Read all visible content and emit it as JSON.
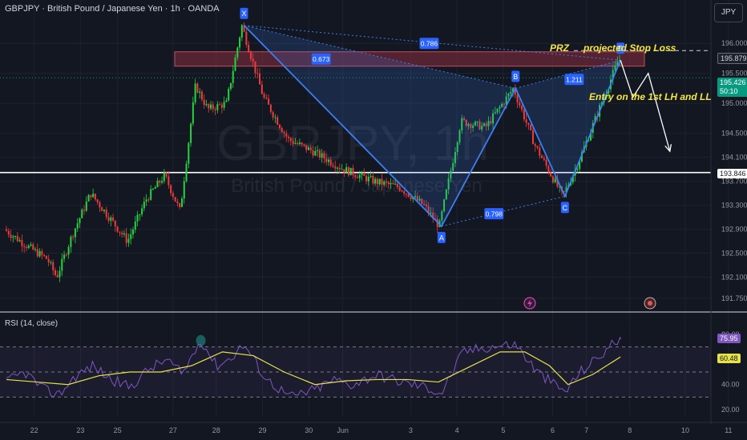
{
  "header": {
    "symbol_title": "GBPJPY · British Pound / Japanese Yen · 1h · OANDA",
    "currency_button": "JPY"
  },
  "watermark": {
    "symbol": "GBPJPY, 1h",
    "description": "British Pound / Japanese Yen"
  },
  "colors": {
    "background": "#131722",
    "grid": "#1e2230",
    "up": "#26d340",
    "down": "#ef3b3b",
    "pattern": "#3d7ef0",
    "rsi_line": "#7e57c2",
    "rsi_ma": "#e6e24a",
    "zone": "#8b2e40",
    "annotation": "#f5e63c",
    "support": "#ffffff"
  },
  "price_tags": {
    "stop": "195.879",
    "current": "195.426",
    "countdown": "50:10",
    "support": "193.846",
    "rsi_value": "75.95",
    "rsi_ma_value": "60.48"
  },
  "annotations": {
    "prz": "PRZ",
    "stop_loss": "projected Stop Loss",
    "entry": "Entry on the 1st LH and LL"
  },
  "pattern": {
    "type": "bat",
    "points": [
      {
        "label": "X",
        "day": 3.85,
        "price": 196.3
      },
      {
        "label": "A",
        "day": 7.05,
        "price": 192.95
      },
      {
        "label": "B",
        "day": 8.25,
        "price": 195.25
      },
      {
        "label": "C",
        "day": 9.05,
        "price": 193.45
      },
      {
        "label": "D",
        "day": 9.95,
        "price": 195.72
      }
    ],
    "ratios": [
      {
        "label": "0.673",
        "day": 5.1,
        "price": 195.74
      },
      {
        "label": "0.786",
        "day": 6.85,
        "price": 196.0
      },
      {
        "label": "1.211",
        "day": 9.2,
        "price": 195.4
      },
      {
        "label": "0.798",
        "day": 7.9,
        "price": 193.16
      }
    ]
  },
  "chart_data": {
    "type": "candlestick",
    "title": "GBPJPY · British Pound / Japanese Yen · 1h · OANDA",
    "x_ticks": [
      "22",
      "23",
      "25",
      "27",
      "28",
      "29",
      "30",
      "Jun",
      "3",
      "4",
      "5",
      "6",
      "7",
      "8",
      "10",
      "11"
    ],
    "y_ticks": [
      "196.000",
      "195.500",
      "195.000",
      "194.500",
      "194.100",
      "193.700",
      "193.300",
      "192.900",
      "192.500",
      "192.100",
      "191.750"
    ],
    "ylim": [
      191.6,
      196.35
    ],
    "prz_zone": [
      195.62,
      195.86
    ],
    "support_level": 193.846,
    "stop_loss_level": 195.879,
    "current_price": 195.426,
    "price_path": [
      [
        0.0,
        192.9
      ],
      [
        0.4,
        192.6
      ],
      [
        0.7,
        192.4
      ],
      [
        0.85,
        192.1
      ],
      [
        1.1,
        192.8
      ],
      [
        1.4,
        193.5
      ],
      [
        1.7,
        193.1
      ],
      [
        2.0,
        192.7
      ],
      [
        2.3,
        193.4
      ],
      [
        2.6,
        193.8
      ],
      [
        2.85,
        193.2
      ],
      [
        3.1,
        195.3
      ],
      [
        3.3,
        194.9
      ],
      [
        3.6,
        195.0
      ],
      [
        3.85,
        196.3
      ],
      [
        4.2,
        195.1
      ],
      [
        4.6,
        194.4
      ],
      [
        5.0,
        194.2
      ],
      [
        5.5,
        193.9
      ],
      [
        6.0,
        193.7
      ],
      [
        6.4,
        193.6
      ],
      [
        6.8,
        193.3
      ],
      [
        7.05,
        192.95
      ],
      [
        7.4,
        194.7
      ],
      [
        7.8,
        194.6
      ],
      [
        8.25,
        195.25
      ],
      [
        8.6,
        194.3
      ],
      [
        9.05,
        193.45
      ],
      [
        9.3,
        194.0
      ],
      [
        9.6,
        194.8
      ],
      [
        9.95,
        195.72
      ]
    ],
    "projection": [
      [
        9.95,
        195.72
      ],
      [
        10.15,
        195.1
      ],
      [
        10.4,
        195.5
      ],
      [
        10.75,
        194.2
      ]
    ],
    "rsi": {
      "title": "RSI (14, close)",
      "y_ticks": [
        "80.00",
        "60.00",
        "40.00",
        "20.00"
      ],
      "ylim": [
        15,
        85
      ],
      "bands": [
        70,
        50,
        30
      ],
      "value": 75.95,
      "ma_value": 60.48,
      "values": [
        [
          0.0,
          42
        ],
        [
          0.3,
          50
        ],
        [
          0.6,
          36
        ],
        [
          0.85,
          32
        ],
        [
          1.1,
          46
        ],
        [
          1.4,
          55
        ],
        [
          1.7,
          44
        ],
        [
          2.0,
          38
        ],
        [
          2.3,
          52
        ],
        [
          2.6,
          60
        ],
        [
          2.85,
          48
        ],
        [
          3.15,
          76
        ],
        [
          3.4,
          55
        ],
        [
          3.6,
          60
        ],
        [
          3.85,
          72
        ],
        [
          4.2,
          45
        ],
        [
          4.6,
          30
        ],
        [
          5.0,
          36
        ],
        [
          5.3,
          44
        ],
        [
          5.6,
          40
        ],
        [
          6.0,
          48
        ],
        [
          6.4,
          42
        ],
        [
          6.8,
          38
        ],
        [
          7.05,
          33
        ],
        [
          7.4,
          66
        ],
        [
          7.8,
          70
        ],
        [
          8.25,
          72
        ],
        [
          8.6,
          50
        ],
        [
          9.05,
          34
        ],
        [
          9.3,
          50
        ],
        [
          9.6,
          62
        ],
        [
          9.95,
          78
        ]
      ],
      "ma": [
        [
          0.0,
          44
        ],
        [
          0.5,
          42
        ],
        [
          1.0,
          40
        ],
        [
          1.5,
          47
        ],
        [
          2.0,
          50
        ],
        [
          2.5,
          50
        ],
        [
          3.0,
          55
        ],
        [
          3.5,
          66
        ],
        [
          4.0,
          63
        ],
        [
          4.5,
          50
        ],
        [
          5.0,
          40
        ],
        [
          5.5,
          43
        ],
        [
          6.0,
          44
        ],
        [
          6.5,
          44
        ],
        [
          7.0,
          42
        ],
        [
          7.5,
          54
        ],
        [
          8.0,
          66
        ],
        [
          8.4,
          66
        ],
        [
          8.8,
          55
        ],
        [
          9.1,
          40
        ],
        [
          9.5,
          48
        ],
        [
          9.95,
          62
        ]
      ]
    }
  }
}
